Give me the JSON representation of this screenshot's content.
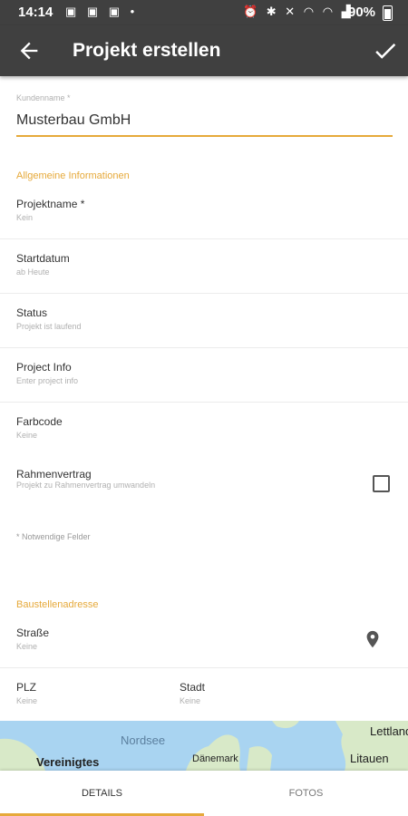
{
  "status_bar": {
    "time": "14:14",
    "battery": "90%"
  },
  "toolbar": {
    "title": "Projekt erstellen"
  },
  "customer": {
    "label": "Kundenname *",
    "value": "Musterbau GmbH"
  },
  "general": {
    "title": "Allgemeine Informationen",
    "rows": [
      {
        "label": "Projektname *",
        "sub": "Kein"
      },
      {
        "label": "Startdatum",
        "sub": "ab Heute"
      },
      {
        "label": "Status",
        "sub": "Projekt ist laufend"
      },
      {
        "label": "Project Info",
        "sub": "Enter project info"
      },
      {
        "label": "Farbcode",
        "sub": "Keine"
      }
    ],
    "rahmen": {
      "label": "Rahmenvertrag",
      "sub": "Projekt zu Rahmenvertrag umwandeln",
      "checked": false
    },
    "note": "* Notwendige Felder"
  },
  "address": {
    "title": "Baustellenadresse",
    "street": {
      "label": "Straße",
      "sub": "Keine"
    },
    "plz": {
      "label": "PLZ",
      "sub": "Keine"
    },
    "city": {
      "label": "Stadt",
      "sub": "Keine"
    }
  },
  "map": {
    "labels": [
      "Nordsee",
      "Vereinigtes",
      "Dänemark",
      "Lettland",
      "Litauen"
    ]
  },
  "tabs": {
    "details": "DETAILS",
    "fotos": "FOTOS"
  },
  "colors": {
    "toolbar": "#404040",
    "accent": "#e6a93a",
    "sea": "#a9d4f1",
    "land": "#d8e9c8"
  }
}
